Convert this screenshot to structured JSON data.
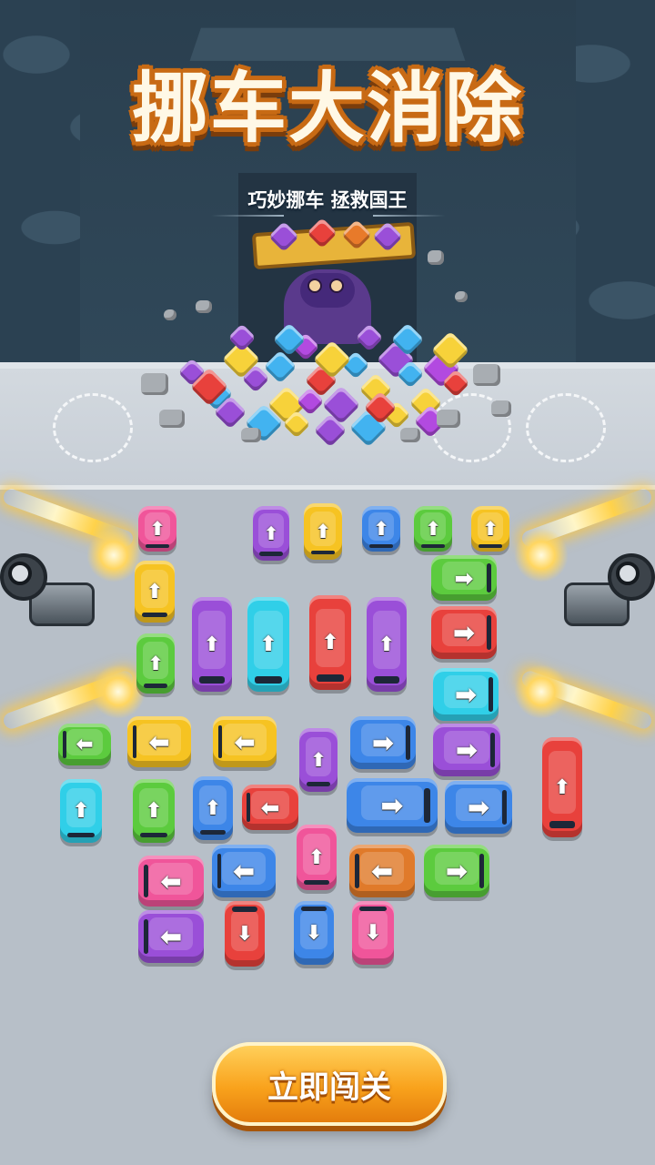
{
  "title": "挪车大消除",
  "subtitle": "巧妙挪车 拯救国王",
  "play_button": "立即闯关",
  "colors": {
    "title_fill": "#fff8e6",
    "title_stroke": "#c86a14",
    "button": "#f9a21c",
    "pink": "#f0559a",
    "purple": "#9a4fd8",
    "yellow": "#f6c322",
    "blue": "#3d86e8",
    "green": "#5ccb3e",
    "cyan": "#30cfe8",
    "red": "#e8413c",
    "orange": "#e07a2a"
  },
  "board": {
    "empty_slots": 3,
    "cars": [
      {
        "color": "pink",
        "dir": "up"
      },
      {
        "color": "purple",
        "dir": "up"
      },
      {
        "color": "yellow",
        "dir": "up"
      },
      {
        "color": "blue",
        "dir": "up"
      },
      {
        "color": "green",
        "dir": "up"
      },
      {
        "color": "yellow",
        "dir": "up"
      },
      {
        "color": "yellow",
        "dir": "up"
      },
      {
        "color": "green",
        "dir": "right"
      },
      {
        "color": "purple",
        "dir": "up"
      },
      {
        "color": "cyan",
        "dir": "up"
      },
      {
        "color": "red",
        "dir": "up"
      },
      {
        "color": "purple",
        "dir": "up"
      },
      {
        "color": "red",
        "dir": "right"
      },
      {
        "color": "green",
        "dir": "up"
      },
      {
        "color": "cyan",
        "dir": "right"
      },
      {
        "color": "green",
        "dir": "left"
      },
      {
        "color": "yellow",
        "dir": "left"
      },
      {
        "color": "yellow",
        "dir": "left"
      },
      {
        "color": "purple",
        "dir": "up"
      },
      {
        "color": "blue",
        "dir": "right"
      },
      {
        "color": "purple",
        "dir": "right"
      },
      {
        "color": "red",
        "dir": "up"
      },
      {
        "color": "cyan",
        "dir": "up"
      },
      {
        "color": "green",
        "dir": "up"
      },
      {
        "color": "blue",
        "dir": "up"
      },
      {
        "color": "red",
        "dir": "left"
      },
      {
        "color": "blue",
        "dir": "right"
      },
      {
        "color": "blue",
        "dir": "right"
      },
      {
        "color": "pink",
        "dir": "left"
      },
      {
        "color": "blue",
        "dir": "left"
      },
      {
        "color": "pink",
        "dir": "up"
      },
      {
        "color": "orange",
        "dir": "left"
      },
      {
        "color": "green",
        "dir": "right"
      },
      {
        "color": "purple",
        "dir": "left"
      },
      {
        "color": "red",
        "dir": "down"
      },
      {
        "color": "blue",
        "dir": "down"
      },
      {
        "color": "pink",
        "dir": "down"
      }
    ]
  }
}
